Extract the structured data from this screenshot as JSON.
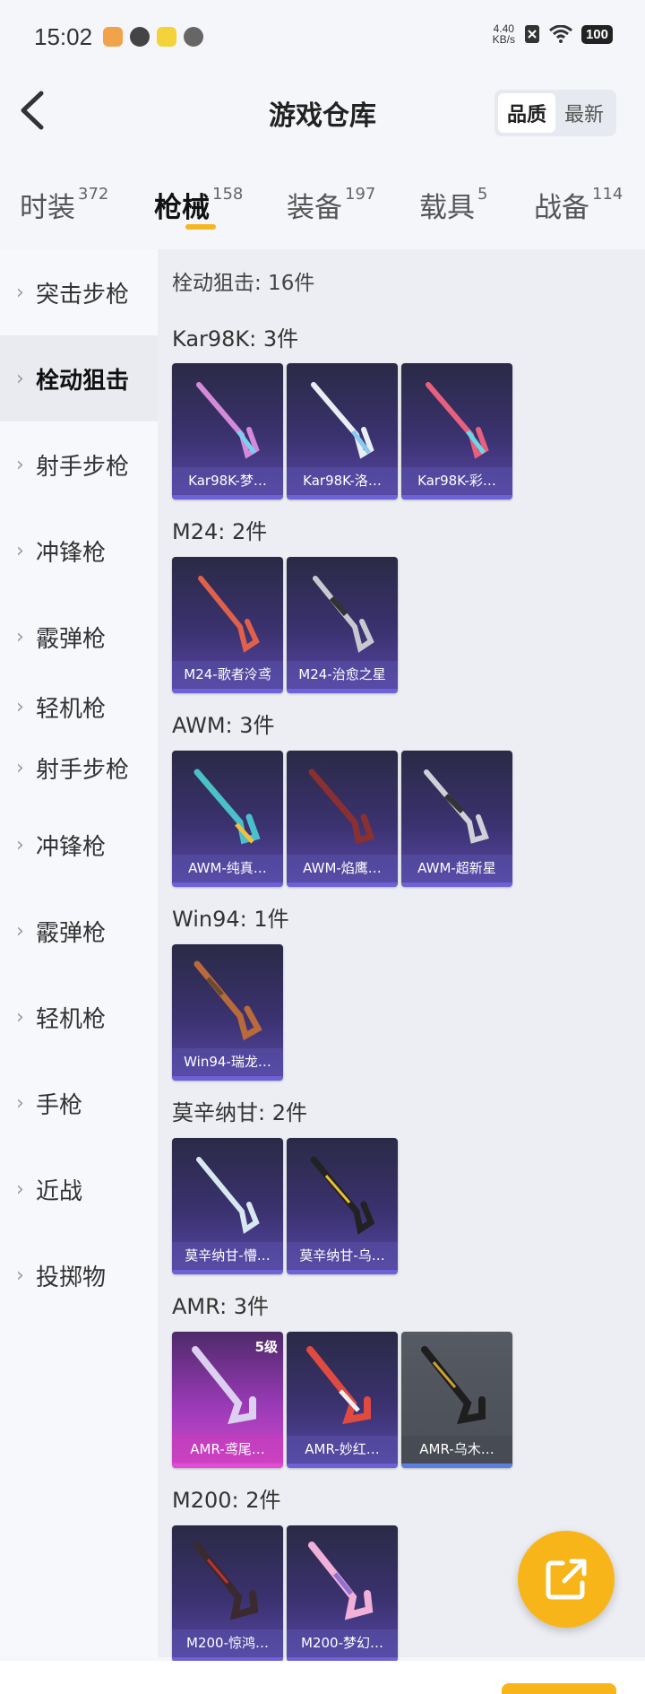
{
  "status_bar": {
    "time": "15:02",
    "net_speed": "4.40",
    "net_unit": "KB/s",
    "battery": "100"
  },
  "header": {
    "title": "游戏仓库",
    "sort_options": [
      "品质",
      "最新"
    ],
    "sort_active": "品质"
  },
  "tabs": [
    {
      "label": "时装",
      "count": "372"
    },
    {
      "label": "枪械",
      "count": "158",
      "active": true
    },
    {
      "label": "装备",
      "count": "197"
    },
    {
      "label": "载具",
      "count": "5"
    },
    {
      "label": "战备",
      "count": "114"
    }
  ],
  "sidebar": {
    "items": [
      "突击步枪",
      "栓动狙击",
      "射手步枪",
      "冲锋枪",
      "霰弹枪",
      "轻机枪",
      "射手步枪",
      "冲锋枪",
      "霰弹枪",
      "轻机枪",
      "手枪",
      "近战",
      "投掷物"
    ],
    "active_index": 1
  },
  "content": {
    "summary": "栓动狙击: 16件",
    "groups": [
      {
        "title": "Kar98K: 3件",
        "items": [
          "Kar98K-梦…",
          "Kar98K-洛…",
          "Kar98K-彩…"
        ]
      },
      {
        "title": "M24: 2件",
        "items": [
          "M24-歌者泠鸢",
          "M24-治愈之星"
        ]
      },
      {
        "title": "AWM: 3件",
        "items": [
          "AWM-纯真…",
          "AWM-焰鹰…",
          "AWM-超新星"
        ]
      },
      {
        "title": "Win94: 1件",
        "items": [
          "Win94-瑞龙…"
        ]
      },
      {
        "title": "莫辛纳甘: 2件",
        "items": [
          "莫辛纳甘-懵…",
          "莫辛纳甘-乌…"
        ]
      },
      {
        "title": "AMR: 3件",
        "items": [
          "AMR-鸢尾…",
          "AMR-妙红…",
          "AMR-乌木…"
        ],
        "level_badge": "5级"
      },
      {
        "title": "M200: 2件",
        "items": [
          "M200-惊鸿…",
          "M200-梦幻…"
        ]
      }
    ]
  },
  "colors": {
    "accent": "#f5b623",
    "card_purple": "#5848a8",
    "card_pink": "#d44ac8",
    "card_gray": "#4a4e56"
  },
  "icons": {
    "back": "chevron-left-icon",
    "fab": "share-external-icon"
  }
}
